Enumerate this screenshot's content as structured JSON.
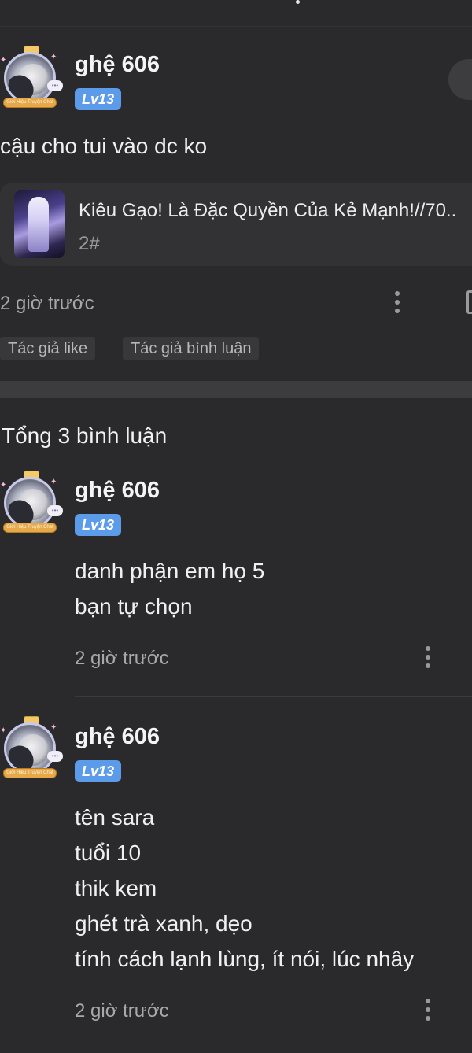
{
  "post": {
    "username": "ghệ 606",
    "level": "Lv13",
    "avatar_badge": "Giới Hiệu Truyện Chat",
    "text": "cậu cho tui vào dc ko",
    "linked_story": {
      "title": "Kiêu Gạo! Là Đặc Quyền Của Kẻ Mạnh!//70..",
      "chapter": "2#"
    },
    "time": "2 giờ trước",
    "tags": [
      "Tác giả like",
      "Tác giả bình luận"
    ],
    "icons": [
      "more-vertical-icon",
      "bookmark-icon"
    ]
  },
  "comments_header": "Tổng 3 bình luận",
  "comments": [
    {
      "username": "ghệ 606",
      "level": "Lv13",
      "lines": [
        "danh phận em họ 5",
        "bạn tự chọn"
      ],
      "time": "2 giờ trước"
    },
    {
      "username": "ghệ 606",
      "level": "Lv13",
      "lines": [
        "tên sara",
        "tuổi 10",
        "thik kem",
        "ghét trà xanh, dẹo",
        "tính cách lạnh lùng, ít nói, lúc nhây"
      ],
      "time": "2 giờ trước"
    }
  ],
  "colors": {
    "background": "#2a2a2c",
    "level_badge": "#5b9bea",
    "card": "#323235",
    "muted_text": "#a8a8ac"
  }
}
